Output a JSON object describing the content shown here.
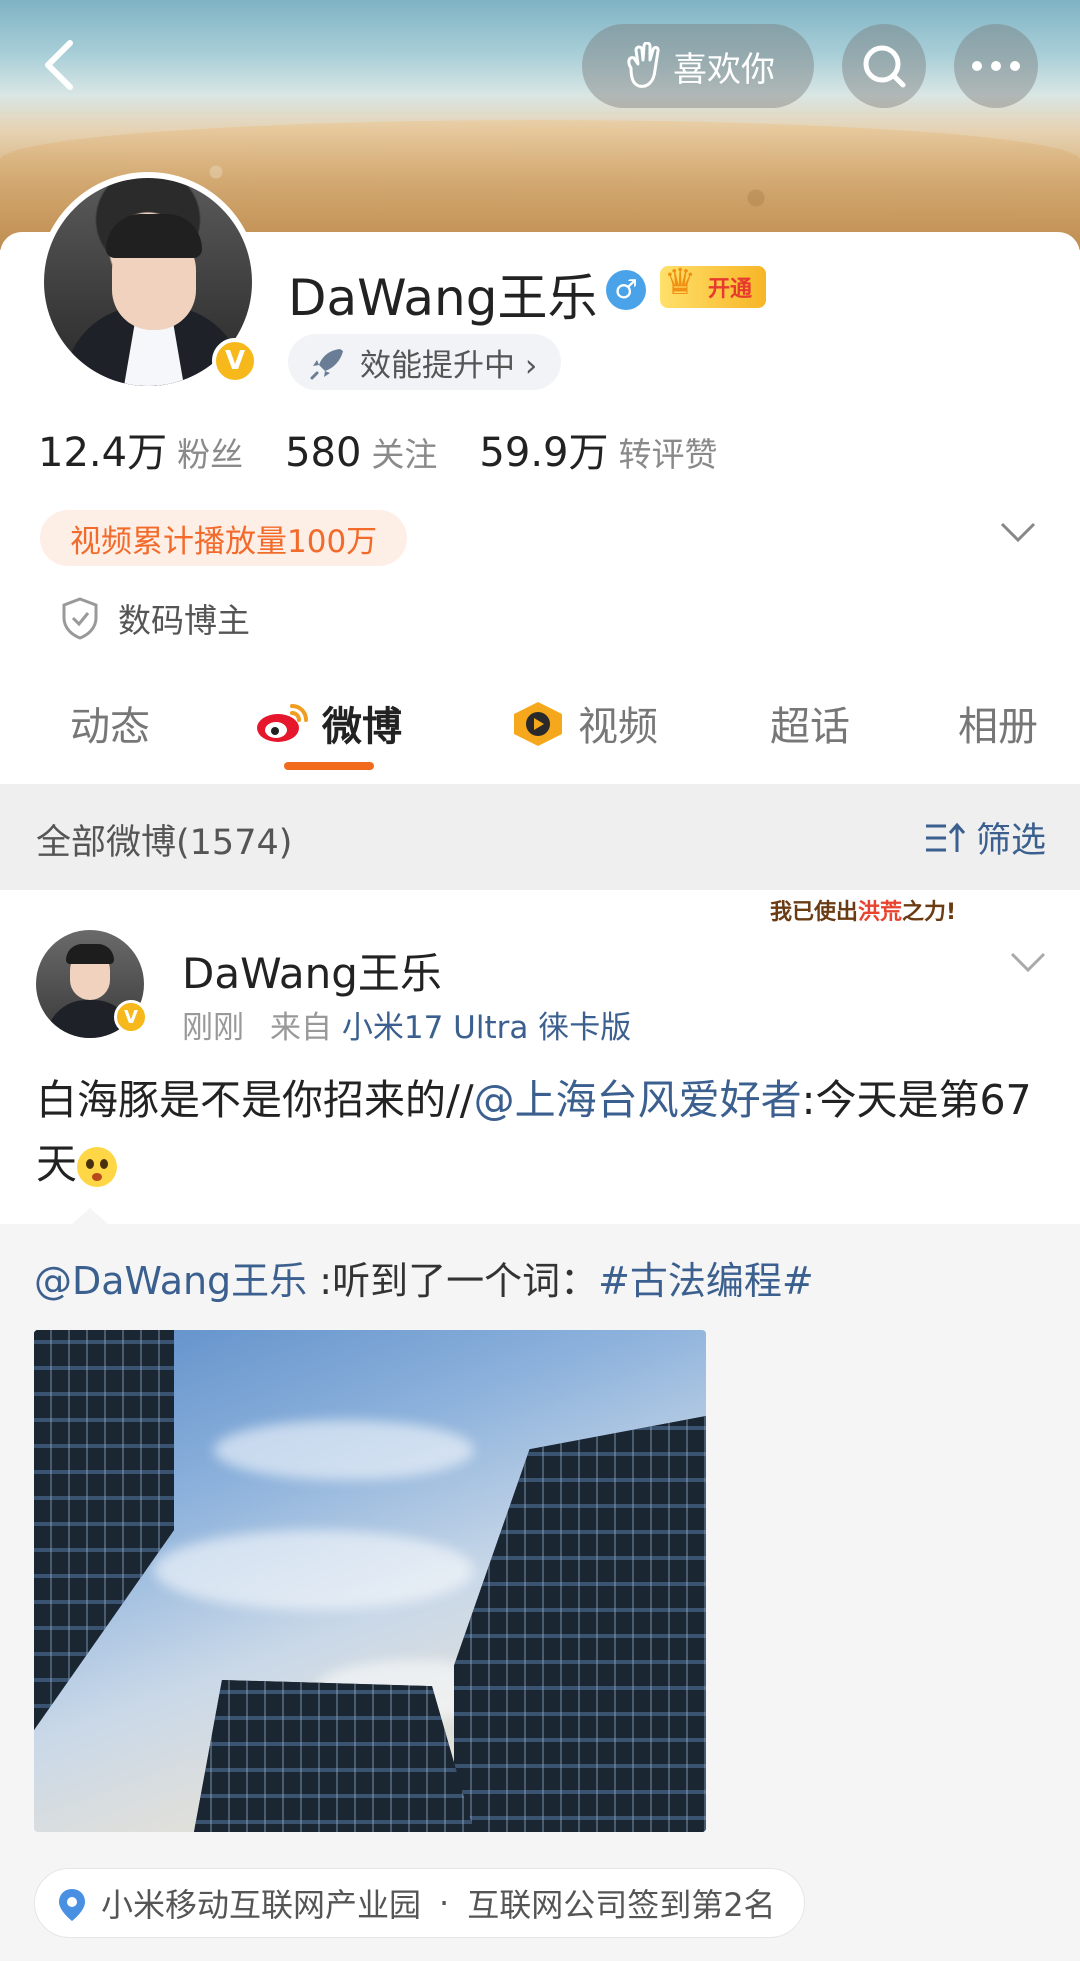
{
  "header": {
    "like_button": "喜欢你"
  },
  "profile": {
    "name": "DaWang王乐",
    "gender_symbol": "♂",
    "vip_label": "开通",
    "verified_badge": "V",
    "boost_label": "效能提升中 ›",
    "stats": [
      {
        "value": "12.4万",
        "label": "粉丝"
      },
      {
        "value": "580",
        "label": "关注"
      },
      {
        "value": "59.9万",
        "label": "转评赞"
      }
    ],
    "play_pill": "视频累计播放量100万",
    "tag": "数码博主"
  },
  "tabs": [
    {
      "label": "动态",
      "active": false
    },
    {
      "label": "微博",
      "active": true
    },
    {
      "label": "视频",
      "active": false
    },
    {
      "label": "超话",
      "active": false
    },
    {
      "label": "相册",
      "active": false
    }
  ],
  "filter_bar": {
    "count_label": "全部微博(1574)",
    "filter_label": "筛选"
  },
  "post": {
    "author": "DaWang王乐",
    "time": "刚刚",
    "source_prefix": "来自",
    "source": "小米17 Ultra 徕卡版",
    "sticker": {
      "prefix": "我已使出",
      "highlight": "洪荒",
      "suffix": "之力!"
    },
    "text_main": "白海豚是不是你招来的//",
    "text_mention": "@上海台风爱好者",
    "text_rest": ":今天是第67天",
    "repost": {
      "mention": "@DaWang王乐",
      "text": " :听到了一个词：",
      "hashtag": "#古法编程#"
    },
    "location": {
      "place": "小米移动互联网产业园",
      "separator": "·",
      "rank_text": "互联网公司签到第2名"
    }
  },
  "colors": {
    "accent_orange": "#f26b1d",
    "link_blue": "#3b5f8e",
    "verified_gold": "#f6b81a",
    "gender_blue": "#4aa3e8"
  }
}
